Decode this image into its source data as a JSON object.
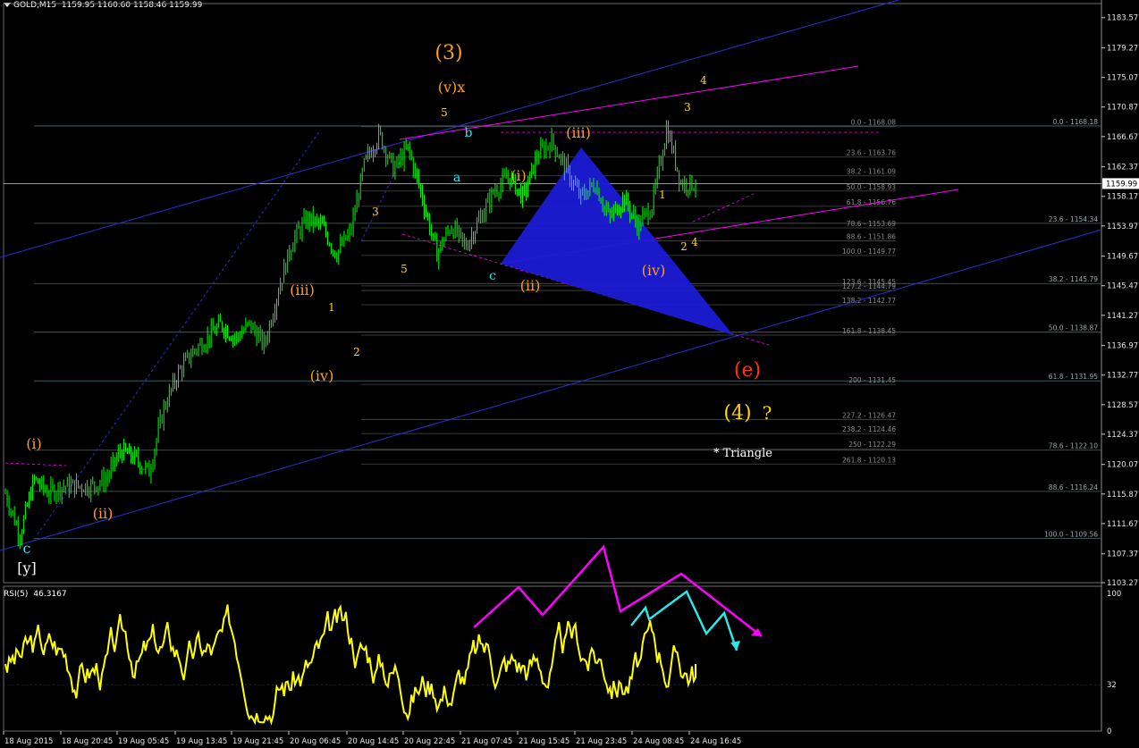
{
  "header": {
    "symbol": "GOLD,M15",
    "open": "1159.95",
    "high": "1160.60",
    "low": "1158.46",
    "close": "1159.99"
  },
  "rsi": {
    "label": "RSI(5)",
    "value": "46.3167",
    "levels": [
      "100",
      "32",
      "0"
    ]
  },
  "colors": {
    "background": "#000000",
    "bull_candle": "#00ff00",
    "rsi_line": "#ffff00",
    "trend_blue": "#2d2dcf",
    "magenta": "#ff00ff",
    "orange": "#ff9f1a",
    "cyan": "#2ee6e6",
    "red_label": "#ff3300"
  },
  "chart_data": {
    "type": "candlestick",
    "symbol": "GOLD",
    "timeframe": "M15",
    "ylim": [
      1103.27,
      1185.57
    ],
    "price_ticks": [
      "1183.57",
      "1179.27",
      "1175.07",
      "1170.87",
      "1166.67",
      "1162.37",
      "1158.17",
      "1153.97",
      "1149.67",
      "1145.47",
      "1141.27",
      "1136.97",
      "1132.77",
      "1128.57",
      "1124.37",
      "1120.07",
      "1115.87",
      "1111.67",
      "1107.37",
      "1103.27"
    ],
    "current_price": "1159.99",
    "x_ticks": [
      "18 Aug 2015",
      "18 Aug 20:45",
      "19 Aug 05:45",
      "19 Aug 13:45",
      "19 Aug 21:45",
      "20 Aug 06:45",
      "20 Aug 14:45",
      "20 Aug 22:45",
      "21 Aug 07:45",
      "21 Aug 15:45",
      "21 Aug 23:45",
      "24 Aug 08:45",
      "24 Aug 16:45"
    ],
    "price_path": [
      1116,
      1110,
      1118,
      1116,
      1117,
      1117,
      1117,
      1118,
      1122,
      1121,
      1119,
      1128,
      1133,
      1136,
      1138,
      1140,
      1138,
      1140,
      1137,
      1145,
      1152,
      1155,
      1154,
      1150,
      1153,
      1163,
      1167,
      1162,
      1165,
      1158,
      1150,
      1154,
      1151,
      1155,
      1159,
      1161,
      1158,
      1164,
      1166,
      1162,
      1158,
      1160,
      1155,
      1158,
      1154,
      1157,
      1168,
      1160,
      1159.99
    ],
    "fib_levels_right": [
      {
        "label": "0.0 - 1168.18",
        "price": 1168.18
      },
      {
        "label": "23.6 - 1154.34",
        "price": 1154.34
      },
      {
        "label": "38.2 - 1145.79",
        "price": 1145.79
      },
      {
        "label": "50.0 - 1138.87",
        "price": 1138.87
      },
      {
        "label": "61.8 - 1131.95",
        "price": 1131.95
      },
      {
        "label": "78.6 - 1122.10",
        "price": 1122.1
      },
      {
        "label": "88.6 - 1116.24",
        "price": 1116.24
      },
      {
        "label": "100.0 - 1109.56",
        "price": 1109.56
      }
    ],
    "fib_levels_mid": [
      {
        "label": "0.0 - 1168.08",
        "price": 1168.08
      },
      {
        "label": "23.6 - 1163.76",
        "price": 1163.76
      },
      {
        "label": "38.2 - 1161.09",
        "price": 1161.09
      },
      {
        "label": "50.0 - 1158.93",
        "price": 1158.93
      },
      {
        "label": "61.8 - 1156.76",
        "price": 1156.76
      },
      {
        "label": "78.6 - 1153.69",
        "price": 1153.69
      },
      {
        "label": "88.6 - 1151.86",
        "price": 1151.86
      },
      {
        "label": "100.0 - 1149.77",
        "price": 1149.77
      },
      {
        "label": "123.6 - 1145.45",
        "price": 1145.45
      },
      {
        "label": "127.2 - 1144.79",
        "price": 1144.79
      },
      {
        "label": "138.2 - 1142.77",
        "price": 1142.77
      },
      {
        "label": "161.8 - 1138.45",
        "price": 1138.45
      },
      {
        "label": "200 - 1131.45",
        "price": 1131.45
      },
      {
        "label": "227.2 - 1126.47",
        "price": 1126.47
      },
      {
        "label": "238.2 - 1124.46",
        "price": 1124.46
      },
      {
        "label": "250 - 1122.29",
        "price": 1122.29
      },
      {
        "label": "261.8 - 1120.13",
        "price": 1120.13
      }
    ],
    "wave_labels": [
      {
        "text": "(3)",
        "color": "#ff9f1a"
      },
      {
        "text": "(v)x",
        "color": "#ff9f1a"
      },
      {
        "text": "5",
        "color": "#ffd700"
      },
      {
        "text": "b",
        "color": "#2ee6e6"
      },
      {
        "text": "a",
        "color": "#2ee6e6"
      },
      {
        "text": "(iii)",
        "color": "#ff9f1a"
      },
      {
        "text": "(i)",
        "color": "#ff9f1a"
      },
      {
        "text": "3",
        "color": "#ffd700"
      },
      {
        "text": "5",
        "color": "#ffd700"
      },
      {
        "text": "1",
        "color": "#ffd700"
      },
      {
        "text": "2",
        "color": "#ffd700"
      },
      {
        "text": "4",
        "color": "#ffd700"
      },
      {
        "text": "3",
        "color": "#ffd700"
      },
      {
        "text": "4",
        "color": "#ffd700"
      },
      {
        "text": "c",
        "color": "#2ee6e6"
      },
      {
        "text": "(ii)",
        "color": "#ff9f1a"
      },
      {
        "text": "(iv)",
        "color": "#ff9f1a"
      },
      {
        "text": "(iii)",
        "color": "#ff9f1a"
      },
      {
        "text": "1",
        "color": "#ffd700"
      },
      {
        "text": "(iv)",
        "color": "#ff9f1a"
      },
      {
        "text": "2",
        "color": "#ffd700"
      },
      {
        "text": "(e)",
        "color": "#ff3300"
      },
      {
        "text": "(4)",
        "color": "#ffd700"
      },
      {
        "text": "?",
        "color": "#ffd700"
      },
      {
        "text": "* Triangle",
        "color": "#ffffff"
      },
      {
        "text": "(i)",
        "color": "#ff9f1a"
      },
      {
        "text": "(ii)",
        "color": "#ff9f1a"
      },
      {
        "text": "c",
        "color": "#2ee6e6"
      },
      {
        "text": "[y]",
        "color": "#ffffff"
      }
    ]
  }
}
